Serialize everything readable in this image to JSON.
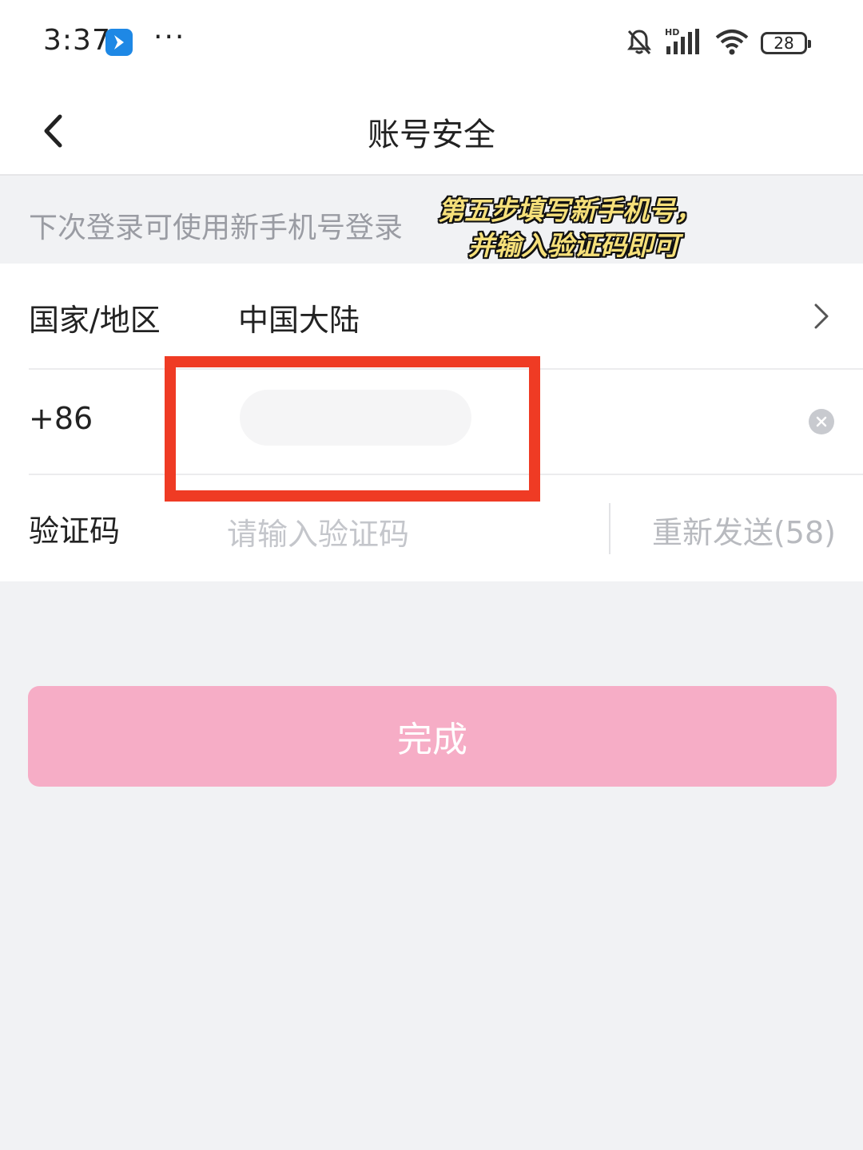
{
  "status_bar": {
    "time": "3:37",
    "more": "···",
    "battery": "28",
    "network": "HD"
  },
  "header": {
    "title": "账号安全"
  },
  "hint": {
    "text": "下次登录可使用新手机号登录"
  },
  "annotation": {
    "line1": "第五步填写新手机号，",
    "line2": "并输入验证码即可"
  },
  "form": {
    "region": {
      "label": "国家/地区",
      "value": "中国大陆"
    },
    "phone": {
      "prefix": "+86",
      "value": ""
    },
    "code": {
      "label": "验证码",
      "placeholder": "请输入验证码",
      "resend": "重新发送(58)"
    }
  },
  "done_button": {
    "label": "完成"
  },
  "colors": {
    "highlight": "#ef3b24",
    "done_button": "#f6adc6",
    "annotation_text": "#f6e07a"
  }
}
